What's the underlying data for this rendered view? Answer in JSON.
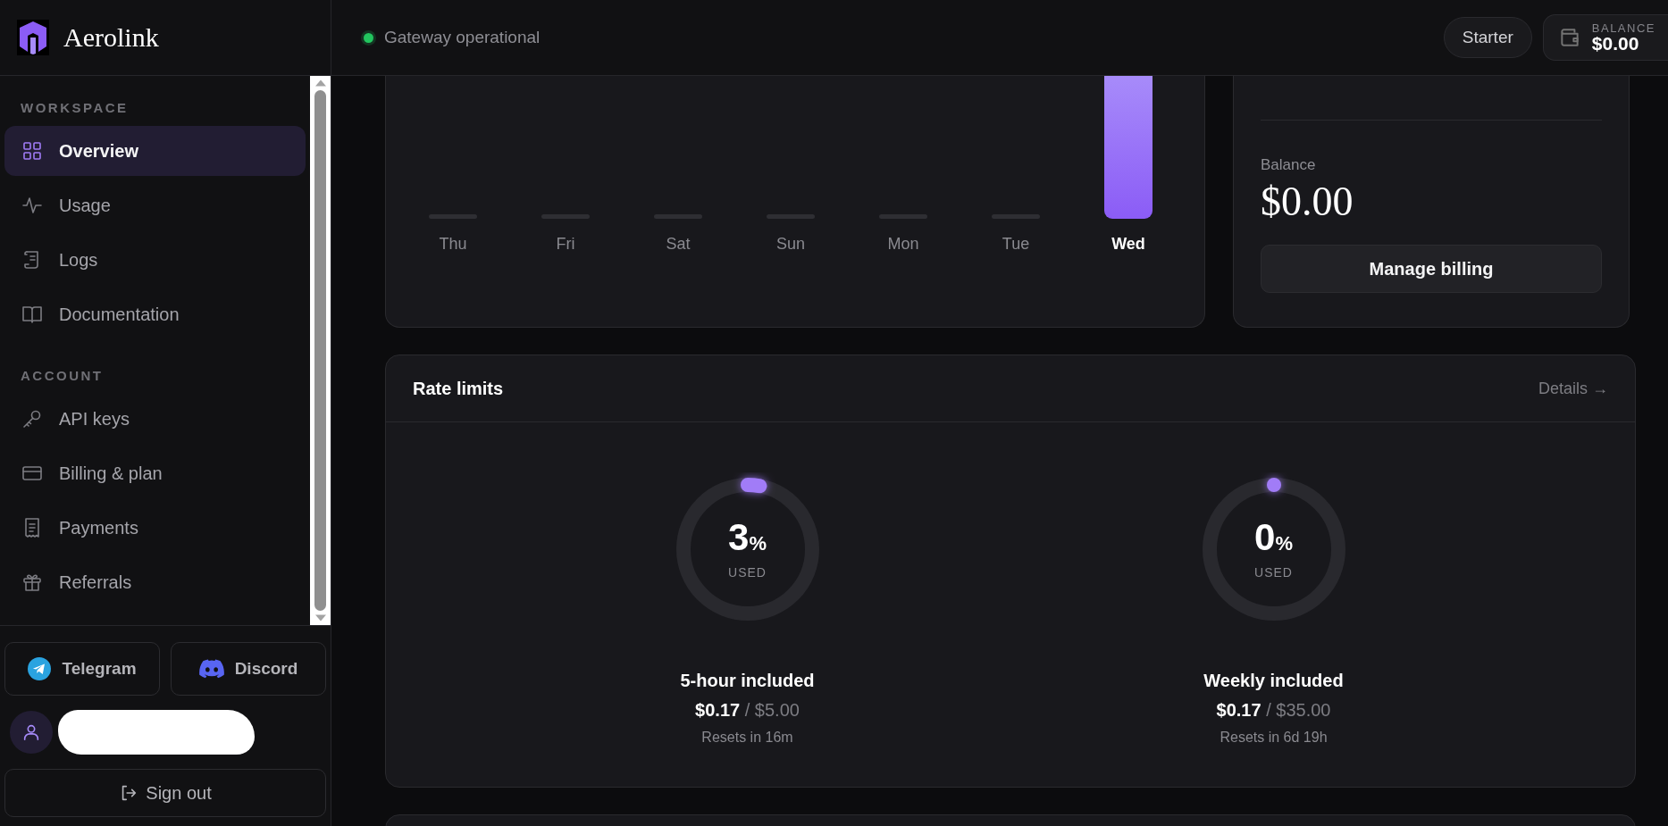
{
  "brand": {
    "name": "Aerolink"
  },
  "header": {
    "status": {
      "label": "Gateway operational",
      "color": "#22c55e"
    },
    "plan_pill": "Starter",
    "balance": {
      "label": "BALANCE",
      "amount": "$0.00"
    }
  },
  "sidebar": {
    "sections": [
      {
        "title": "WORKSPACE",
        "items": [
          {
            "label": "Overview",
            "selected": true
          },
          {
            "label": "Usage",
            "selected": false
          },
          {
            "label": "Logs",
            "selected": false
          },
          {
            "label": "Documentation",
            "selected": false
          }
        ]
      },
      {
        "title": "ACCOUNT",
        "items": [
          {
            "label": "API keys",
            "selected": false
          },
          {
            "label": "Billing & plan",
            "selected": false
          },
          {
            "label": "Payments",
            "selected": false
          },
          {
            "label": "Referrals",
            "selected": false
          }
        ]
      }
    ],
    "social": [
      {
        "label": "Telegram"
      },
      {
        "label": "Discord"
      }
    ],
    "sign_out": "Sign out"
  },
  "usage_chart": {
    "days": [
      {
        "label": "Thu",
        "selected": false
      },
      {
        "label": "Fri",
        "selected": false
      },
      {
        "label": "Sat",
        "selected": false
      },
      {
        "label": "Sun",
        "selected": false
      },
      {
        "label": "Mon",
        "selected": false
      },
      {
        "label": "Tue",
        "selected": false
      },
      {
        "label": "Wed",
        "selected": true
      }
    ]
  },
  "plan_card": {
    "balance_label": "Balance",
    "balance": "$0.00",
    "button": "Manage billing"
  },
  "rate_limits": {
    "title": "Rate limits",
    "details_link": "Details →",
    "meters": [
      {
        "value": "3",
        "unit": "%",
        "caption": "USED",
        "level": 0.03,
        "name": "5-hour included",
        "used": "$0.17",
        "limit": "/ $5.00",
        "reset": "Resets in 16m"
      },
      {
        "value": "0",
        "unit": "%",
        "caption": "USED",
        "level": 0.0,
        "name": "Weekly included",
        "used": "$0.17",
        "limit": "/ $35.00",
        "reset": "Resets in 6d 19h"
      }
    ]
  }
}
